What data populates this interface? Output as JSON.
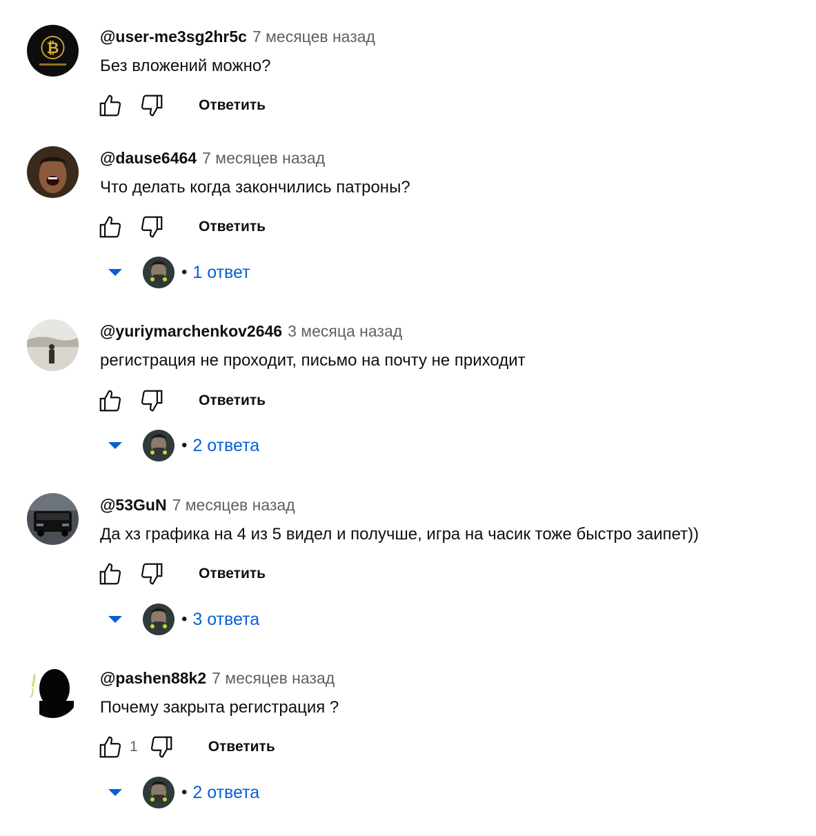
{
  "reply_label": "Ответить",
  "comments": [
    {
      "author": "@user-me3sg2hr5c",
      "time": "7 месяцев назад",
      "text": "Без вложений можно?",
      "avatar_icon": "bitcoin-logo-avatar",
      "likes": "",
      "replies_label": ""
    },
    {
      "author": "@dause6464",
      "time": "7 месяцев назад",
      "text": "Что делать когда закончились патроны?",
      "avatar_icon": "laughing-person-avatar",
      "likes": "",
      "replies_label": "1 ответ"
    },
    {
      "author": "@yuriymarchenkov2646",
      "time": "3 месяца назад",
      "text": "регистрация не проходит, письмо на почту не приходит",
      "avatar_icon": "person-in-snow-avatar",
      "likes": "",
      "replies_label": "2 ответа"
    },
    {
      "author": "@53GuN",
      "time": "7 месяцев назад",
      "text": "Да хз графика на 4 из 5 видел и получше, игра на часик тоже быстро заипет))",
      "avatar_icon": "black-car-avatar",
      "likes": "",
      "replies_label": "3 ответа"
    },
    {
      "author": "@pashen88k2",
      "time": "7 месяцев назад",
      "text": "Почему закрыта регистрация ?",
      "avatar_icon": "silhouette-avatar",
      "likes": "1",
      "replies_label": "2 ответа"
    }
  ],
  "colors": {
    "link_blue": "#065fd4",
    "secondary_text": "#606060",
    "primary_text": "#0f0f0f"
  }
}
